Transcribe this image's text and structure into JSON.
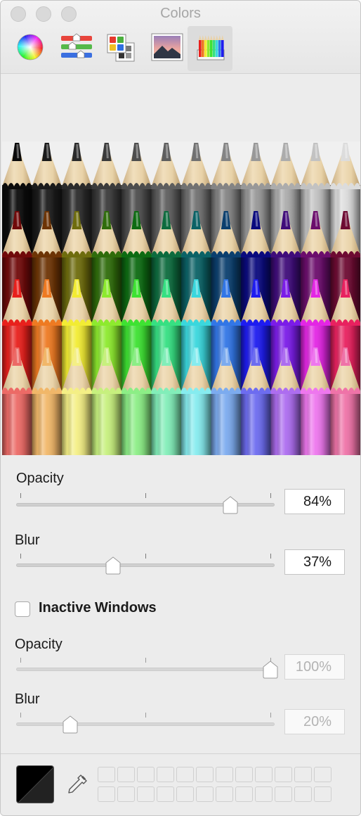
{
  "window": {
    "title": "Colors"
  },
  "toolbar": {
    "tabs": [
      {
        "icon": "color-wheel-icon",
        "selected": false
      },
      {
        "icon": "color-sliders-icon",
        "selected": false
      },
      {
        "icon": "color-palettes-icon",
        "selected": false
      },
      {
        "icon": "image-palettes-icon",
        "selected": false
      },
      {
        "icon": "pencils-icon",
        "selected": true
      }
    ]
  },
  "pencils": {
    "rows": [
      [
        "#0b0b0b",
        "#1b1b1b",
        "#2b2b2b",
        "#3b3b3b",
        "#4d4d4d",
        "#5e5e5e",
        "#717171",
        "#848484",
        "#989898",
        "#acacac",
        "#c2c2c2",
        "#dcdcdc"
      ],
      [
        "#700a0a",
        "#6d3405",
        "#6e6c0d",
        "#2f6c0b",
        "#0d6b12",
        "#0d6b3e",
        "#0b6266",
        "#0b3f6e",
        "#0a0a7e",
        "#3f0c7a",
        "#6b0d6c",
        "#6d0a32"
      ],
      [
        "#e8201c",
        "#ee7a22",
        "#f2ec33",
        "#8dea2e",
        "#3ee232",
        "#36e082",
        "#3ad7dd",
        "#3276e6",
        "#1e1cf0",
        "#7b1ce8",
        "#e326e4",
        "#e8215f"
      ],
      [
        "#ec6a66",
        "#f1b769",
        "#f4ef85",
        "#c7f07e",
        "#8cee86",
        "#82eeb9",
        "#86ecef",
        "#7cabef",
        "#6d6cf0",
        "#ad6df0",
        "#ee77ee",
        "#ef73a8"
      ]
    ]
  },
  "active": {
    "opacity_label": "Opacity",
    "opacity_value": "84%",
    "opacity_level": 84,
    "blur_label": "Blur",
    "blur_value": "37%",
    "blur_level": 37
  },
  "inactive": {
    "checkbox_label": "Inactive Windows",
    "checked": false,
    "opacity_label": "Opacity",
    "opacity_value": "100%",
    "opacity_level": 100,
    "blur_label": "Blur",
    "blur_value": "20%",
    "blur_level": 20
  },
  "bottom": {
    "current_color": "#000000",
    "swatch_rows": 2,
    "swatch_cols": 12
  }
}
